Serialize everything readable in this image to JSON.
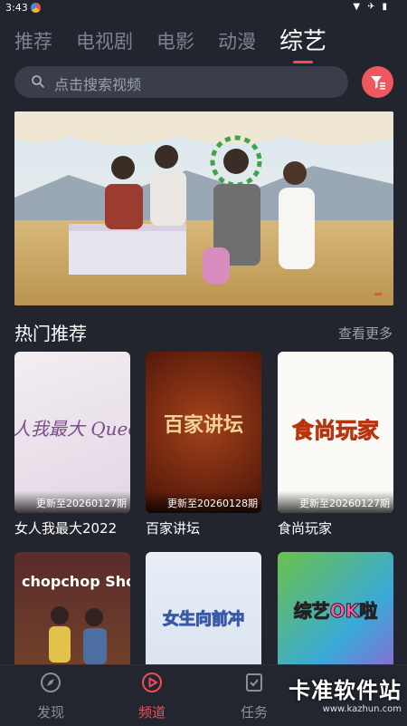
{
  "status": {
    "time": "3:43"
  },
  "tabs": [
    {
      "label": "推荐"
    },
    {
      "label": "电视剧"
    },
    {
      "label": "电影"
    },
    {
      "label": "动漫"
    },
    {
      "label": "综艺"
    }
  ],
  "search": {
    "placeholder": "点击搜索视频"
  },
  "section": {
    "title": "热门推荐",
    "more": "查看更多"
  },
  "cards": [
    {
      "title": "女人我最大2022",
      "update": "更新至20260127期",
      "thumb_text": "女人我最大 Queen"
    },
    {
      "title": "百家讲坛",
      "update": "更新至20260128期",
      "thumb_text": "百家讲坛"
    },
    {
      "title": "食尚玩家",
      "update": "更新至20260127期",
      "thumb_text": "食尚玩家"
    },
    {
      "title": "",
      "update": "",
      "thumb_text": "chopchop Show"
    },
    {
      "title": "",
      "update": "",
      "thumb_text": "女生向前冲"
    },
    {
      "title": "",
      "update": "",
      "thumb_text": "综艺OK啦"
    }
  ],
  "nav": [
    {
      "label": "发现",
      "icon": "compass-icon"
    },
    {
      "label": "频道",
      "icon": "play-icon"
    },
    {
      "label": "任务",
      "icon": "task-icon"
    }
  ],
  "watermark": {
    "big": "卡准软件站",
    "small": "www.kazhun.com"
  },
  "colors": {
    "accent": "#f24b58",
    "background": "#22252e",
    "search_bg": "#3a3e4a"
  }
}
